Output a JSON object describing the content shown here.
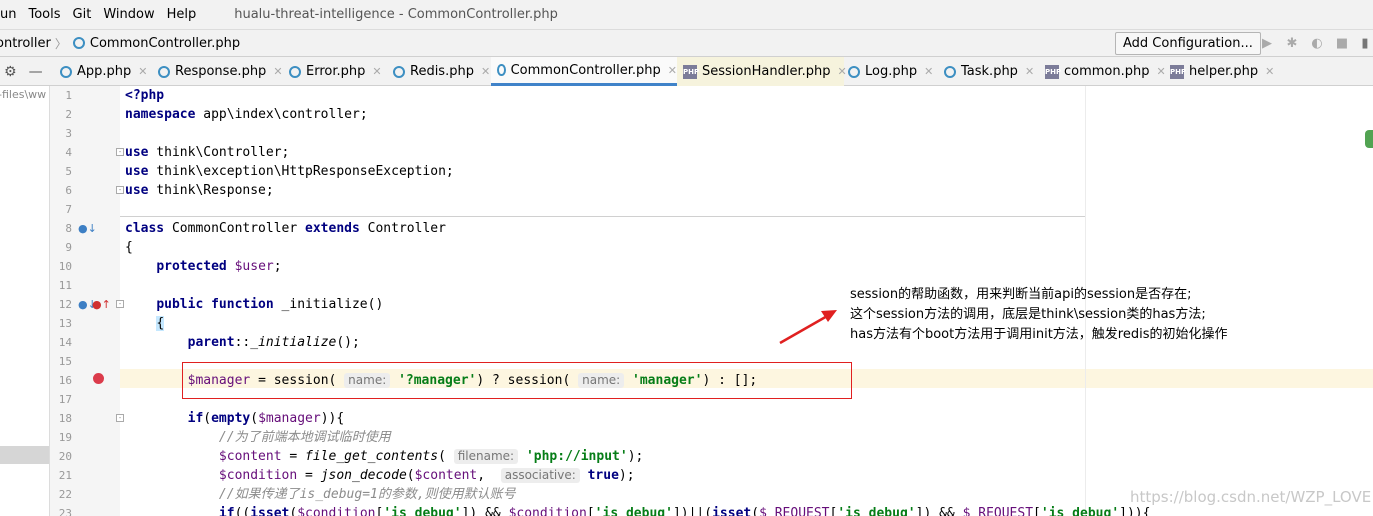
{
  "menubar": {
    "items": [
      "un",
      "Tools",
      "Git",
      "Window",
      "Help"
    ],
    "window_title": "hualu-threat-intelligence - CommonController.php"
  },
  "navbar": {
    "breadcrumb": [
      "ontroller",
      "CommonController.php"
    ],
    "add_configuration": "Add Configuration..."
  },
  "tabs": [
    {
      "label": "App.php",
      "icon": "php-class-icon"
    },
    {
      "label": "Response.php",
      "icon": "php-class-icon"
    },
    {
      "label": "Error.php",
      "icon": "php-class-icon"
    },
    {
      "label": "Redis.php",
      "icon": "php-class-icon"
    },
    {
      "label": "CommonController.php",
      "icon": "php-class-icon",
      "active": true
    },
    {
      "label": "SessionHandler.php",
      "icon": "php-file-icon"
    },
    {
      "label": "Log.php",
      "icon": "php-class-icon"
    },
    {
      "label": "Task.php",
      "icon": "php-class-icon"
    },
    {
      "label": "common.php",
      "icon": "php-file-icon"
    },
    {
      "label": "helper.php",
      "icon": "php-file-icon"
    }
  ],
  "sidebar": {
    "path_text": "-files\\ww"
  },
  "editor": {
    "line_numbers": [
      "1",
      "2",
      "3",
      "4",
      "5",
      "6",
      "7",
      "8",
      "9",
      "10",
      "11",
      "12",
      "13",
      "14",
      "15",
      "16",
      "17",
      "18",
      "19",
      "20",
      "21",
      "22",
      "23"
    ],
    "comment_line_19": "//为了前端本地调试临时使用",
    "comment_line_22": "//如果传递了is_debug=1的参数,则使用默认账号",
    "hint_name": "name:",
    "hint_filename": "filename:",
    "hint_associative": "associative:"
  },
  "annotation": {
    "lines": [
      "session的帮助函数，用来判断当前api的session是否存在;",
      "这个session方法的调用，底层是think\\session类的has方法;",
      "has方法有个boot方法用于调用init方法，触发redis的初始化操作"
    ]
  },
  "watermark": "https://blog.csdn.net/WZP_LOVE",
  "colors": {
    "keyword": "#000080",
    "string": "#067d17",
    "variable": "#660e7a",
    "annotation_arrow": "#e02020"
  }
}
